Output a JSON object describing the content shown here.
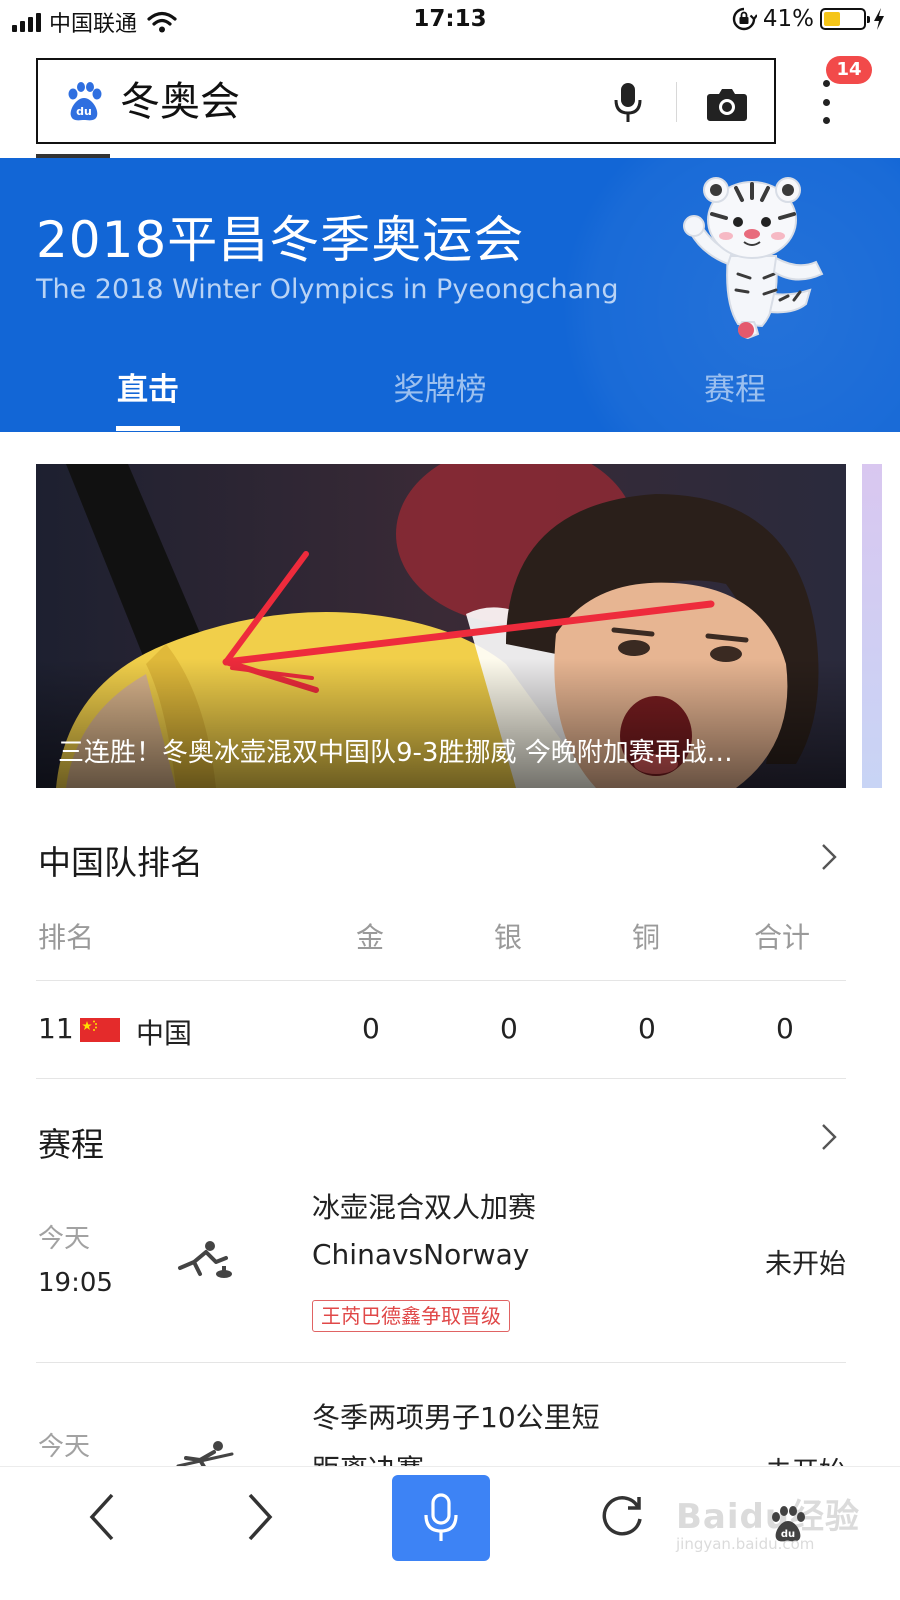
{
  "status_bar": {
    "carrier": "中国联通",
    "time": "17:13",
    "battery_percent": "41%",
    "battery_level": 0.41
  },
  "search": {
    "query": "冬奥会",
    "notification_count": "14"
  },
  "banner": {
    "title": "2018平昌冬季奥运会",
    "subtitle": "The 2018 Winter Olympics in Pyeongchang",
    "background_color": "#1266d6",
    "tabs": [
      {
        "label": "直击",
        "active": true
      },
      {
        "label": "奖牌榜",
        "active": false
      },
      {
        "label": "赛程",
        "active": false
      }
    ]
  },
  "news": {
    "caption": "三连胜！冬奥冰壶混双中国队9-3胜挪威 今晚附加赛再战…"
  },
  "ranking": {
    "title": "中国队排名",
    "headers": [
      "排名",
      "金",
      "银",
      "铜",
      "合计"
    ],
    "row": {
      "rank": "11",
      "country": "中国",
      "gold": "0",
      "silver": "0",
      "bronze": "0",
      "total": "0"
    }
  },
  "schedule": {
    "title": "赛程",
    "items": [
      {
        "day": "今天",
        "time": "19:05",
        "event_line1": "冰壶混合双人加赛",
        "event_line2": "ChinavsNorway",
        "status": "未开始",
        "tag": "王芮巴德鑫争取晋级",
        "icon": "curling-icon"
      },
      {
        "day": "今天",
        "event_line1": "冬季两项男子10公里短",
        "event_line2": "距离决赛",
        "status": "未开始",
        "icon": "skiing-icon"
      }
    ]
  },
  "watermark": {
    "text": "Baidu经验",
    "url_text": "jingyan.baidu.com"
  }
}
